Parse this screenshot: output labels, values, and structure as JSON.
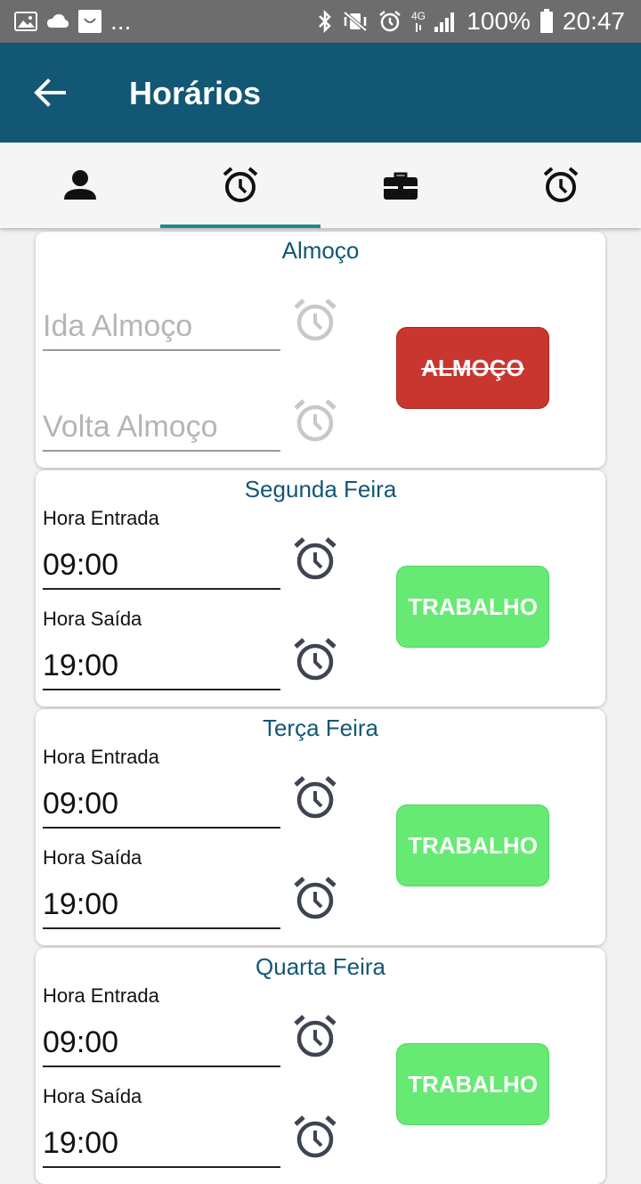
{
  "status_bar": {
    "left_icons": [
      "image-icon",
      "cloud-icon",
      "smile-notification-icon"
    ],
    "more": "...",
    "battery": "100%",
    "time": "20:47"
  },
  "app_bar": {
    "title": "Horários"
  },
  "tabs": [
    {
      "icon": "person-icon",
      "selected": false
    },
    {
      "icon": "alarm-clock-icon",
      "selected": true
    },
    {
      "icon": "briefcase-icon",
      "selected": false
    },
    {
      "icon": "alarm-clock-icon",
      "selected": false
    }
  ],
  "lunch_card": {
    "title": "Almoço",
    "start_placeholder": "Ida Almoço",
    "end_placeholder": "Volta Almoço",
    "button_label": "ALMOÇO"
  },
  "days": [
    {
      "title": "Segunda Feira",
      "start_label": "Hora Entrada",
      "start_value": "09:00",
      "end_label": "Hora Saída",
      "end_value": "19:00",
      "button_label": "TRABALHO"
    },
    {
      "title": "Terça Feira",
      "start_label": "Hora Entrada",
      "start_value": "09:00",
      "end_label": "Hora Saída",
      "end_value": "19:00",
      "button_label": "TRABALHO"
    },
    {
      "title": "Quarta Feira",
      "start_label": "Hora Entrada",
      "start_value": "09:00",
      "end_label": "Hora Saída",
      "end_value": "19:00",
      "button_label": "TRABALHO"
    }
  ],
  "colors": {
    "app_bar": "#125774",
    "tab_indicator": "#1c8c86",
    "lunch_button": "#c9362f",
    "work_button": "#66ea73",
    "card_title": "#125774"
  }
}
